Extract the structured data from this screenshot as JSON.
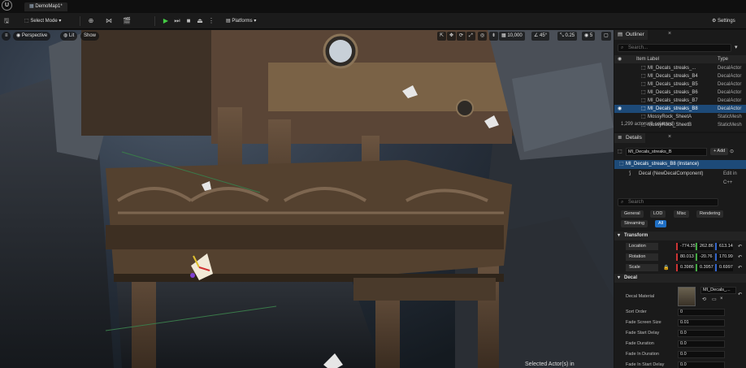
{
  "app": {
    "tab_title": "DemoMap1*",
    "settings_label": "Settings"
  },
  "toolbar": {
    "select_mode_label": "Select Mode",
    "platforms_label": "Platforms"
  },
  "viewport": {
    "view_mode": "Perspective",
    "lit_label": "Lit",
    "show_label": "Show",
    "grid_snap": "10,000",
    "rotation_snap": "45°",
    "scale_snap": "0.25",
    "camera_speed": "5",
    "status_text": "Selected Actor(s) in"
  },
  "outliner": {
    "tab_label": "Outliner",
    "search_placeholder": "Search...",
    "col_label": "Item Label",
    "col_type": "Type",
    "rows": [
      {
        "label": "MI_Decals_streaks_...",
        "type": "DecalActor",
        "selected": false
      },
      {
        "label": "MI_Decals_streaks_B4",
        "type": "DecalActor",
        "selected": false
      },
      {
        "label": "MI_Decals_streaks_B5",
        "type": "DecalActor",
        "selected": false
      },
      {
        "label": "MI_Decals_streaks_B6",
        "type": "DecalActor",
        "selected": false
      },
      {
        "label": "MI_Decals_streaks_B7",
        "type": "DecalActor",
        "selected": false
      },
      {
        "label": "MI_Decals_streaks_B8",
        "type": "DecalActor",
        "selected": true
      },
      {
        "label": "MossyRock_SheetA",
        "type": "StaticMesh",
        "selected": false
      },
      {
        "label": "MossyRock_SheetB",
        "type": "StaticMesh",
        "selected": false
      }
    ],
    "actor_count": "1,299 actors (1 selected)"
  },
  "details": {
    "tab_label": "Details",
    "actor_name": "MI_Decals_streaks_B",
    "add_label": "+ Add",
    "instance_label": "MI_Decals_streaks_B8 (Instance)",
    "component_label": "Decal (NewDecalComponent)",
    "edit_link": "Edit in C++",
    "search_placeholder": "Search",
    "filters": [
      "General",
      "LOD",
      "Misc",
      "Rendering",
      "Streaming",
      "All"
    ],
    "transform_section": "Transform",
    "location": {
      "label": "Location",
      "x": "-774.35",
      "y": "262.86",
      "z": "613.14"
    },
    "rotation": {
      "label": "Rotation",
      "x": "80.013",
      "y": "-20.76",
      "z": "170.99"
    },
    "scale": {
      "label": "Scale",
      "x": "0.3986",
      "y": "0.3957",
      "z": "0.6997"
    },
    "decal_section": "Decal",
    "decal_material_label": "Decal Material",
    "decal_material_value": "MI_Decals_...",
    "props": [
      {
        "label": "Sort Order",
        "value": "0"
      },
      {
        "label": "Fade Screen Size",
        "value": "0.01"
      },
      {
        "label": "Fade Start Delay",
        "value": "0.0"
      },
      {
        "label": "Fade Duration",
        "value": "0.0"
      },
      {
        "label": "Fade In Duration",
        "value": "0.0"
      },
      {
        "label": "Fade In Start Delay",
        "value": "0.0"
      }
    ]
  }
}
